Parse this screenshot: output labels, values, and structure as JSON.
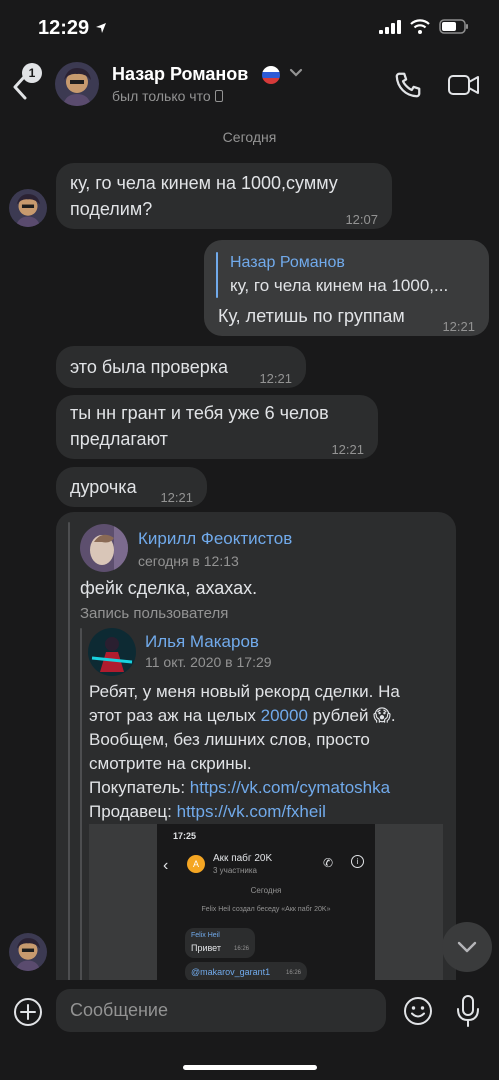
{
  "status_bar": {
    "time": "12:29"
  },
  "header": {
    "unread_count": "1",
    "name": "Назар Романов",
    "status": "был только что"
  },
  "date_separator": "Сегодня",
  "messages": [
    {
      "text1": "ку, го чела кинем на 1000,сумму",
      "text2": "поделим?",
      "time": "12:07"
    },
    {
      "reply_name": "Назар Романов",
      "reply_text": "ку, го чела кинем на 1000,...",
      "text": "Ку, летишь по группам",
      "time": "12:21"
    },
    {
      "text": "это была проверка",
      "time": "12:21"
    },
    {
      "text1": "ты нн грант и тебя уже 6 челов",
      "text2": "предлагают",
      "time": "12:21"
    },
    {
      "text": "дурочка",
      "time": "12:21"
    }
  ],
  "forward": {
    "author": "Кирилл Феоктистов",
    "date": "сегодня в 12:13",
    "text": "фейк сделка, ахахах.",
    "repost_label": "Запись пользователя",
    "nested": {
      "author": "Илья Макаров",
      "date": "11 окт. 2020 в 17:29",
      "line1": "Ребят, у меня новый рекорд сделки. На",
      "line2_a": "этот раз аж на целых ",
      "line2_num": "20000",
      "line2_b": " рублей 😱.",
      "line3": "Вообщем, без лишних слов, просто",
      "line4": "смотрите на скрины.",
      "buyer_label": "Покупатель: ",
      "buyer_link": "https://vk.com/cymatoshka",
      "seller_label": "Продавец: ",
      "seller_link": "https://vk.com/fxheil"
    },
    "screenshot": {
      "time": "17:25",
      "avatar_letter": "А",
      "chat_title": "Акк пабг 20K",
      "members": "3 участника",
      "date": "Сегодня",
      "service_msg": "Felix Heil создал беседу «Акк пабг 20K»",
      "msg1_name": "Felix Heil",
      "msg1_text": "Привет",
      "msg1_time": "16:26",
      "msg2_text": "@makarov_garant1",
      "msg2_time": "16:26"
    }
  },
  "composer": {
    "placeholder": "Сообщение"
  },
  "colors": {
    "background": "#19191a",
    "bubble": "#2c2d2e",
    "accent": "#71aaeb",
    "muted": "#939393"
  },
  "icons": [
    "location-arrow-icon",
    "signal-icon",
    "wifi-icon",
    "battery-icon",
    "back-chevron-icon",
    "phone-icon",
    "video-camera-icon",
    "chevron-down-icon",
    "mobile-device-icon",
    "attach-plus-icon",
    "emoji-icon",
    "microphone-icon",
    "scroll-down-chevron-icon"
  ]
}
